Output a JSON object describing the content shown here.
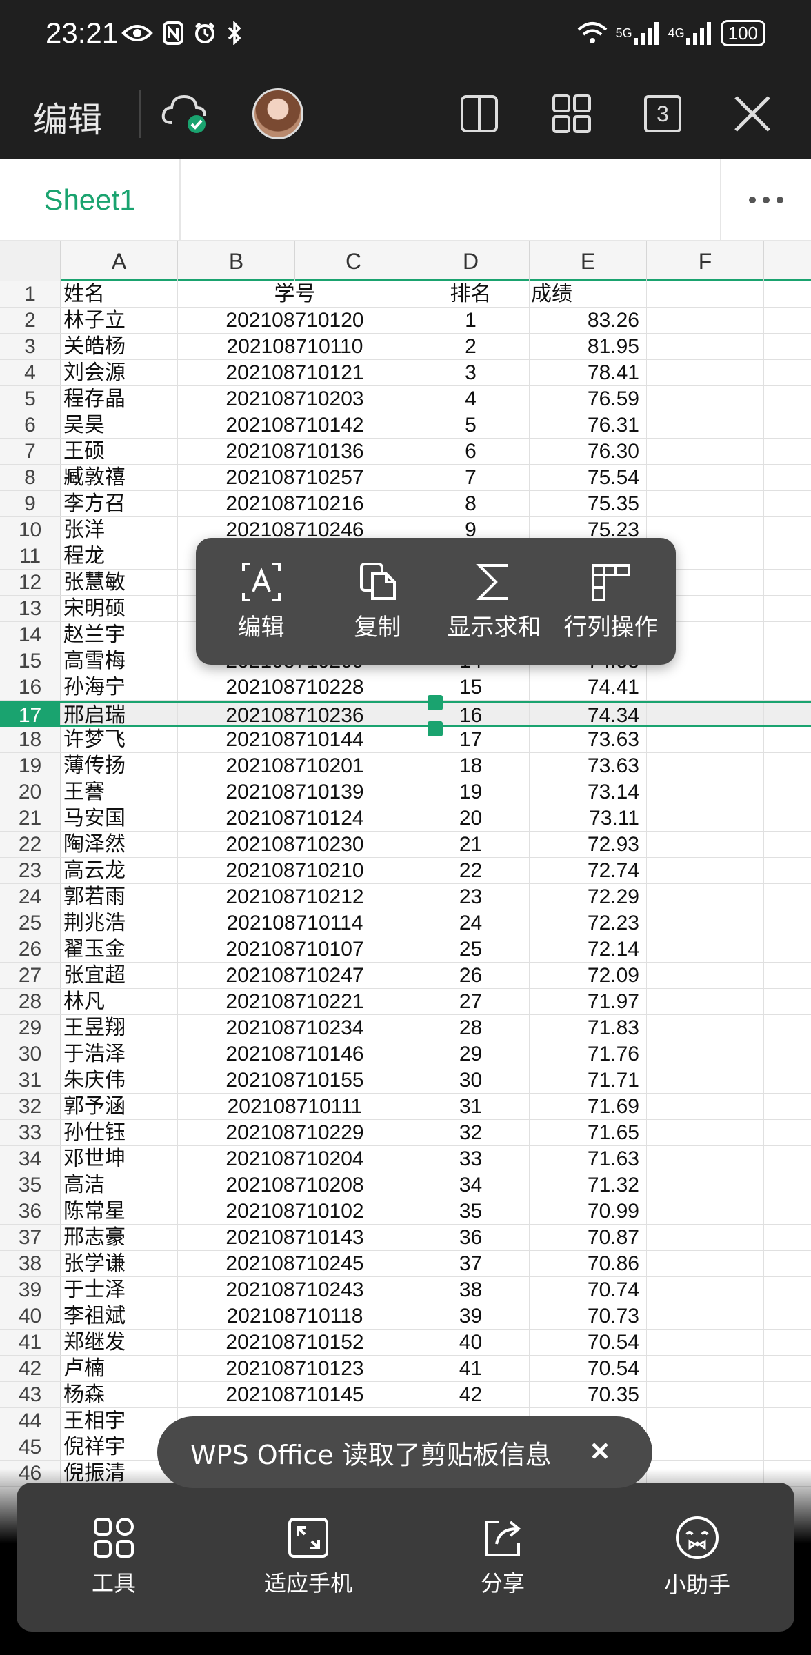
{
  "status_bar": {
    "time": "23:21",
    "battery": "100",
    "signal_5g": "5G",
    "signal_4g": "4G"
  },
  "toolbar": {
    "edit_label": "编辑",
    "tab_count": "3"
  },
  "sheet": {
    "tab_name": "Sheet1"
  },
  "columns": [
    "A",
    "B",
    "C",
    "D",
    "E",
    "F"
  ],
  "rows": [
    {
      "n": "1",
      "name": "姓名",
      "id": "学号",
      "rank": "排名",
      "score": "成绩"
    },
    {
      "n": "2",
      "name": "林子立",
      "id": "202108710120",
      "rank": "1",
      "score": "83.26"
    },
    {
      "n": "3",
      "name": "关皓杨",
      "id": "202108710110",
      "rank": "2",
      "score": "81.95"
    },
    {
      "n": "4",
      "name": "刘会源",
      "id": "202108710121",
      "rank": "3",
      "score": "78.41"
    },
    {
      "n": "5",
      "name": "程存晶",
      "id": "202108710203",
      "rank": "4",
      "score": "76.59"
    },
    {
      "n": "6",
      "name": "吴昊",
      "id": "202108710142",
      "rank": "5",
      "score": "76.31"
    },
    {
      "n": "7",
      "name": "王硕",
      "id": "202108710136",
      "rank": "6",
      "score": "76.30"
    },
    {
      "n": "8",
      "name": "臧敦禧",
      "id": "202108710257",
      "rank": "7",
      "score": "75.54"
    },
    {
      "n": "9",
      "name": "李方召",
      "id": "202108710216",
      "rank": "8",
      "score": "75.35"
    },
    {
      "n": "10",
      "name": "张洋",
      "id": "202108710246",
      "rank": "9",
      "score": "75.23"
    },
    {
      "n": "11",
      "name": "程龙",
      "id": "",
      "rank": "",
      "score": ""
    },
    {
      "n": "12",
      "name": "张慧敏",
      "id": "",
      "rank": "",
      "score": ""
    },
    {
      "n": "13",
      "name": "宋明硕",
      "id": "",
      "rank": "",
      "score": ""
    },
    {
      "n": "14",
      "name": "赵兰宇",
      "id": "",
      "rank": "",
      "score": ""
    },
    {
      "n": "15",
      "name": "高雪梅",
      "id": "202108710209",
      "rank": "14",
      "score": "74.58"
    },
    {
      "n": "16",
      "name": "孙海宁",
      "id": "202108710228",
      "rank": "15",
      "score": "74.41"
    },
    {
      "n": "17",
      "name": "邢启瑞",
      "id": "202108710236",
      "rank": "16",
      "score": "74.34"
    },
    {
      "n": "18",
      "name": "许梦飞",
      "id": "202108710144",
      "rank": "17",
      "score": "73.63"
    },
    {
      "n": "19",
      "name": "薄传扬",
      "id": "202108710201",
      "rank": "18",
      "score": "73.63"
    },
    {
      "n": "20",
      "name": "王謇",
      "id": "202108710139",
      "rank": "19",
      "score": "73.14"
    },
    {
      "n": "21",
      "name": "马安国",
      "id": "202108710124",
      "rank": "20",
      "score": "73.11"
    },
    {
      "n": "22",
      "name": "陶泽然",
      "id": "202108710230",
      "rank": "21",
      "score": "72.93"
    },
    {
      "n": "23",
      "name": "高云龙",
      "id": "202108710210",
      "rank": "22",
      "score": "72.74"
    },
    {
      "n": "24",
      "name": "郭若雨",
      "id": "202108710212",
      "rank": "23",
      "score": "72.29"
    },
    {
      "n": "25",
      "name": "荆兆浩",
      "id": "202108710114",
      "rank": "24",
      "score": "72.23"
    },
    {
      "n": "26",
      "name": "翟玉金",
      "id": "202108710107",
      "rank": "25",
      "score": "72.14"
    },
    {
      "n": "27",
      "name": "张宜超",
      "id": "202108710247",
      "rank": "26",
      "score": "72.09"
    },
    {
      "n": "28",
      "name": "林凡",
      "id": "202108710221",
      "rank": "27",
      "score": "71.97"
    },
    {
      "n": "29",
      "name": "王昱翔",
      "id": "202108710234",
      "rank": "28",
      "score": "71.83"
    },
    {
      "n": "30",
      "name": "于浩泽",
      "id": "202108710146",
      "rank": "29",
      "score": "71.76"
    },
    {
      "n": "31",
      "name": "朱庆伟",
      "id": "202108710155",
      "rank": "30",
      "score": "71.71"
    },
    {
      "n": "32",
      "name": "郭予涵",
      "id": "202108710111",
      "rank": "31",
      "score": "71.69"
    },
    {
      "n": "33",
      "name": "孙仕钰",
      "id": "202108710229",
      "rank": "32",
      "score": "71.65"
    },
    {
      "n": "34",
      "name": "邓世坤",
      "id": "202108710204",
      "rank": "33",
      "score": "71.63"
    },
    {
      "n": "35",
      "name": "高洁",
      "id": "202108710208",
      "rank": "34",
      "score": "71.32"
    },
    {
      "n": "36",
      "name": "陈常星",
      "id": "202108710102",
      "rank": "35",
      "score": "70.99"
    },
    {
      "n": "37",
      "name": "邢志豪",
      "id": "202108710143",
      "rank": "36",
      "score": "70.87"
    },
    {
      "n": "38",
      "name": "张学谦",
      "id": "202108710245",
      "rank": "37",
      "score": "70.86"
    },
    {
      "n": "39",
      "name": "于士泽",
      "id": "202108710243",
      "rank": "38",
      "score": "70.74"
    },
    {
      "n": "40",
      "name": "李祖斌",
      "id": "202108710118",
      "rank": "39",
      "score": "70.73"
    },
    {
      "n": "41",
      "name": "郑继发",
      "id": "202108710152",
      "rank": "40",
      "score": "70.54"
    },
    {
      "n": "42",
      "name": "卢楠",
      "id": "202108710123",
      "rank": "41",
      "score": "70.54"
    },
    {
      "n": "43",
      "name": "杨森",
      "id": "202108710145",
      "rank": "42",
      "score": "70.35"
    },
    {
      "n": "44",
      "name": "王相宇",
      "id": "",
      "rank": "",
      "score": ""
    },
    {
      "n": "45",
      "name": "倪祥宇",
      "id": "",
      "rank": "",
      "score": ""
    },
    {
      "n": "46",
      "name": "倪振清",
      "id": "",
      "rank": "",
      "score": ""
    }
  ],
  "selected_row": "17",
  "context_menu": {
    "edit": "编辑",
    "copy": "复制",
    "sum": "显示求和",
    "rowcol": "行列操作"
  },
  "toast": {
    "message": "WPS Office 读取了剪贴板信息"
  },
  "bottom_panel": {
    "tools": "工具",
    "fit": "适应手机",
    "share": "分享",
    "assistant": "小助手"
  },
  "colors": {
    "accent": "#1aa36f",
    "dark_bar": "#1f1f1f",
    "menu_bg": "#4a4a4a"
  }
}
